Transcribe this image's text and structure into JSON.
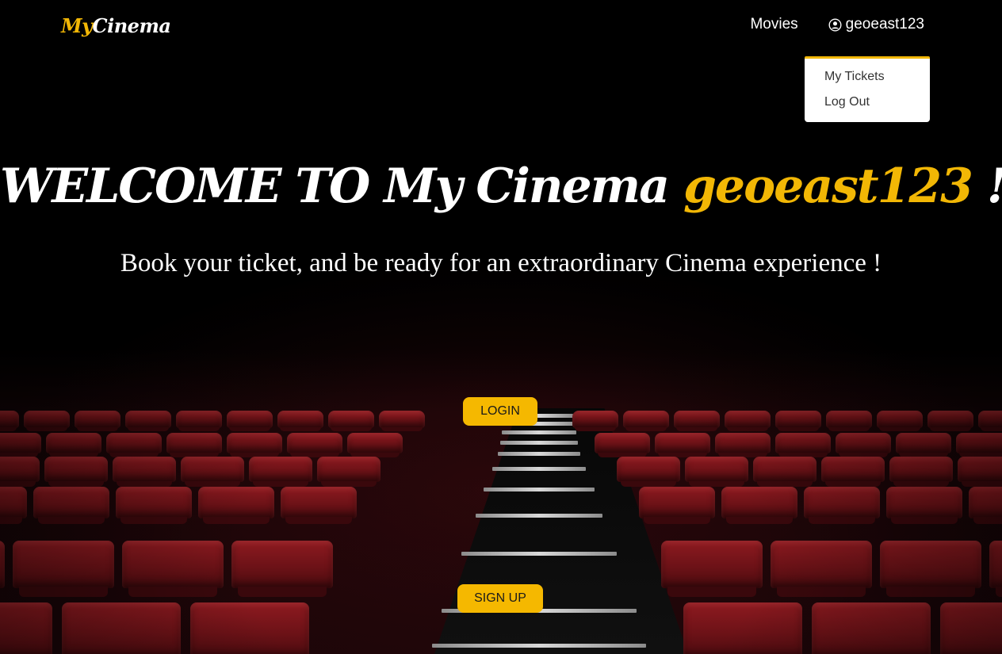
{
  "brand": {
    "logo_my": "My",
    "logo_cinema": "Cinema",
    "accent_color": "#f2b705"
  },
  "nav": {
    "movies": "Movies",
    "user_icon": "user-circle-icon",
    "username": "geoeast123"
  },
  "dropdown": {
    "items": [
      "My Tickets",
      "Log Out"
    ]
  },
  "hero": {
    "welcome": "WELCOME TO My Cinema ",
    "username": "geoeast123",
    "exclaim": " ! ! !",
    "subtitle": "Book your ticket, and be ready for an extraordinary Cinema experience !"
  },
  "buttons": {
    "login": "LOGIN",
    "signup": "SIGN UP"
  }
}
